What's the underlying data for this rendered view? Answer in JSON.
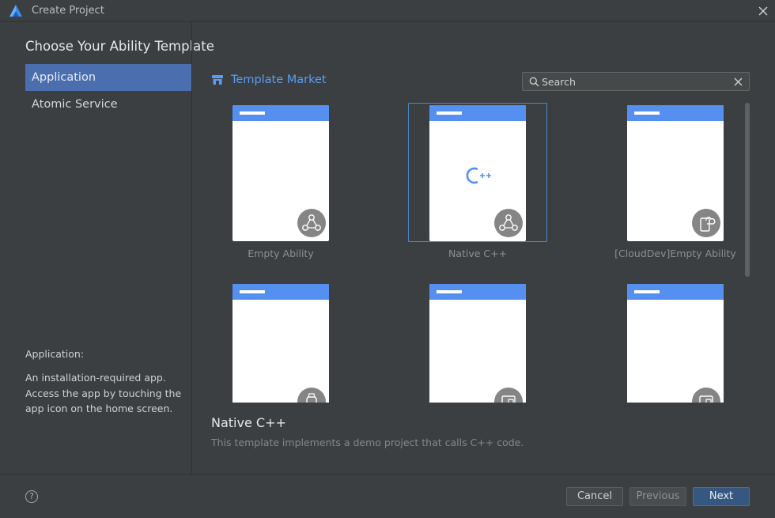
{
  "window": {
    "title": "Create Project"
  },
  "header": {
    "title": "Choose Your Ability Template"
  },
  "sidebar": {
    "items": [
      {
        "label": "Application",
        "active": true
      },
      {
        "label": "Atomic Service",
        "active": false
      }
    ],
    "description_title": "Application:",
    "description": "An installation-required app. Access the app by touching the app icon on the home screen."
  },
  "market": {
    "label": "Template Market",
    "color": "#589df6"
  },
  "search": {
    "placeholder": "Search",
    "value": ""
  },
  "templates": [
    {
      "label": "Empty Ability",
      "badge_icon": "network-icon",
      "selected": false
    },
    {
      "label": "Native C++",
      "badge_icon": "network-icon",
      "center_icon": "cpp-icon",
      "selected": true
    },
    {
      "label": "[CloudDev]Empty Ability",
      "badge_icon": "cloud-device-icon",
      "selected": false
    },
    {
      "label": "",
      "badge_icon": "watch-icon",
      "selected": false
    },
    {
      "label": "",
      "badge_icon": "tablet-icon",
      "selected": false
    },
    {
      "label": "",
      "badge_icon": "tablet-icon",
      "selected": false
    }
  ],
  "detail": {
    "title": "Native C++",
    "description": "This template implements a demo project that calls C++ code."
  },
  "footer": {
    "help_label": "?",
    "cancel_label": "Cancel",
    "previous_label": "Previous",
    "next_label": "Next"
  },
  "colors": {
    "accent": "#4b6eaf",
    "primary_button": "#365880",
    "card_header": "#5590f0",
    "selection": "#4a88c7"
  }
}
